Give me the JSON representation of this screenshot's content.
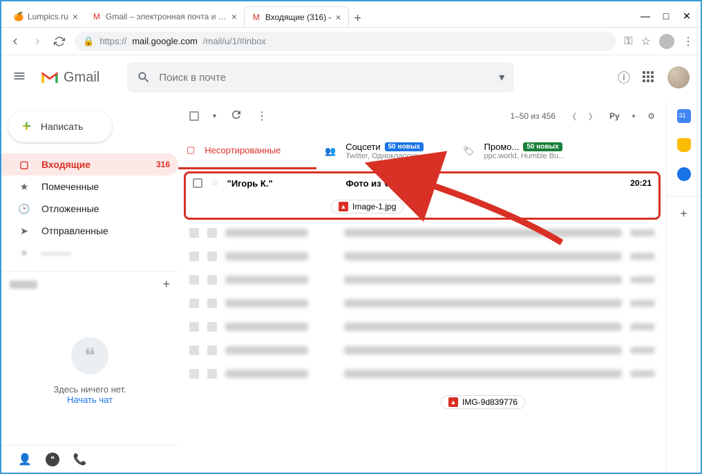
{
  "browser": {
    "tabs": [
      {
        "title": "Lumpics.ru",
        "active": false
      },
      {
        "title": "Gmail – электронная почта и бе",
        "active": false
      },
      {
        "title": "Входящие (316) -",
        "active": true
      }
    ],
    "url_prefix": "https://",
    "url_host": "mail.google.com",
    "url_path": "/mail/u/1/#inbox"
  },
  "gmail": {
    "app_name": "Gmail",
    "search_placeholder": "Поиск в почте",
    "compose": "Написать",
    "nav": [
      {
        "label": "Входящие",
        "count": "316",
        "active": true,
        "icon": "inbox"
      },
      {
        "label": "Помеченные",
        "icon": "star"
      },
      {
        "label": "Отложенные",
        "icon": "clock"
      },
      {
        "label": "Отправленные",
        "icon": "send"
      }
    ],
    "hangouts_empty": "Здесь ничего нет.",
    "hangouts_cta": "Начать чат",
    "toolbar": {
      "range": "1–50 из 456",
      "lang": "Ру"
    },
    "categories": [
      {
        "label": "Несортированные",
        "active": true
      },
      {
        "label": "Соцсети",
        "badge": "50 новых",
        "sub": "Twitter, Однокласcни..."
      },
      {
        "label": "Промо...",
        "badge": "50 новых",
        "sub": "ppc.world, Humble Bu..."
      }
    ],
    "highlight_mail": {
      "sender": "\"Игорь К.\"",
      "subject": "Фото из Viber",
      "time": "20:21",
      "attachment": "Image-1.jpg"
    },
    "footer_attachment": "IMG-9d839776"
  }
}
